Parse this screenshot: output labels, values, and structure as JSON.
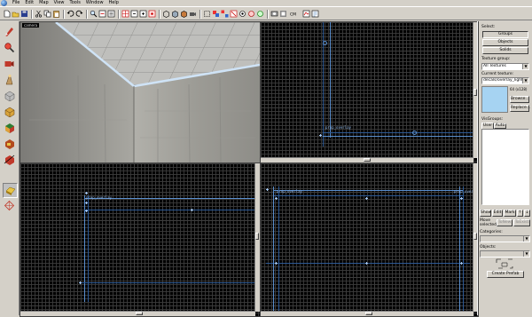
{
  "menubar": {
    "items": [
      "File",
      "Edit",
      "Map",
      "View",
      "Tools",
      "Window",
      "Help"
    ]
  },
  "viewports": {
    "camera": {
      "label": "camera"
    },
    "top_right": {
      "object_label": "prop_overlay"
    },
    "bottom_left": {
      "object_label": "prop_overlay"
    },
    "bottom_right": {
      "object_label": "prop_overlay"
    }
  },
  "panel": {
    "select_label": "Select:",
    "groups_button": "Groups",
    "objects_button": "Objects",
    "solids_button": "Solids",
    "texture_group_label": "Texture group:",
    "texture_group_value": "All Textures",
    "current_texture_label": "Current texture:",
    "current_texture_value": "decals/overlay_light_p",
    "texture_size": "64 (x128)",
    "browse_button": "Browse...",
    "replace_button": "Replace...",
    "visgroups_label": "VisGroups:",
    "tab_user": "User",
    "tab_auto": "Auto",
    "show_button": "Show",
    "edit_button": "Edit",
    "mark_button": "Mark",
    "up_button": "↑",
    "down_button": "↓",
    "move_selected_label": "Move selected:",
    "tonew_button": "ToNew",
    "toexist_button": "ToExist",
    "categories_label": "Categories:",
    "objects_label": "Objects:",
    "create_prefab_button": "Create Prefab"
  },
  "colors": {
    "selection": "#5a8fcf",
    "texture_preview": "#a6d3f2"
  }
}
